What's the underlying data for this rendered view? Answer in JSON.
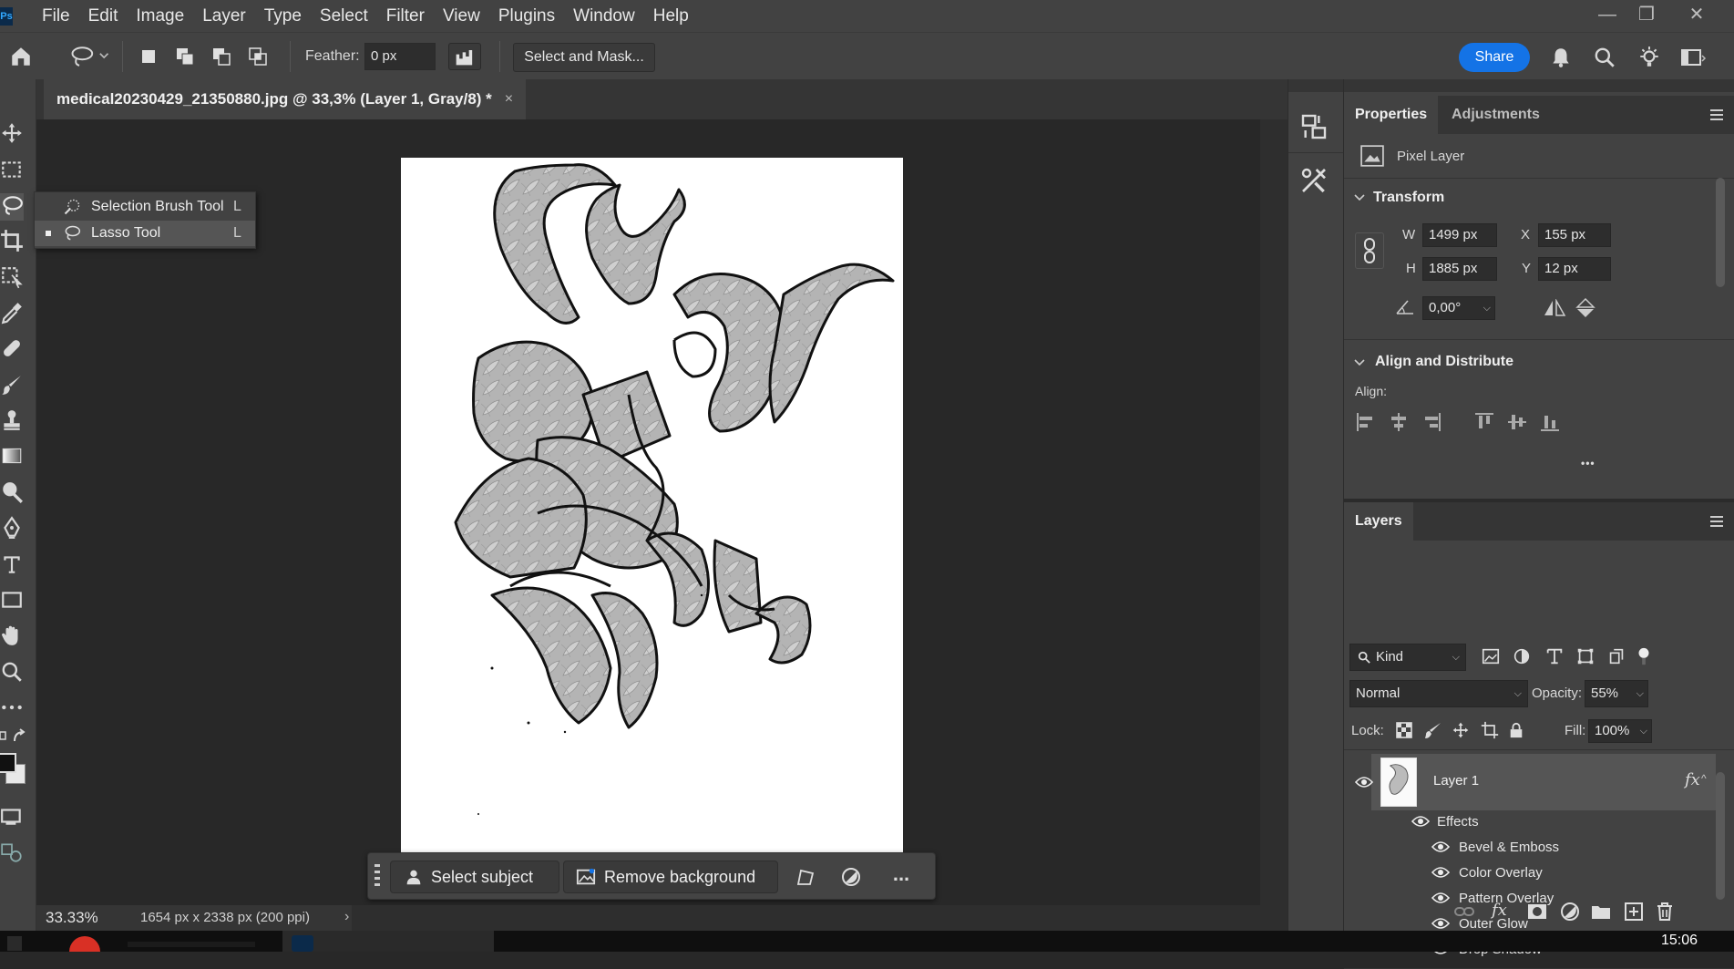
{
  "app": {
    "logo": "Ps"
  },
  "menu": [
    "File",
    "Edit",
    "Image",
    "Layer",
    "Type",
    "Select",
    "Filter",
    "View",
    "Plugins",
    "Window",
    "Help"
  ],
  "window_controls": {
    "minimize": "—",
    "restore": "❐",
    "close": "✕"
  },
  "options": {
    "feather_label": "Feather:",
    "feather_value": "0 px",
    "select_and_mask": "Select and Mask...",
    "share": "Share"
  },
  "document_tab": {
    "title": "medical20230429_21350880.jpg @ 33,3% (Layer 1, Gray/8) *",
    "close": "×"
  },
  "flyout": {
    "items": [
      {
        "label": "Selection Brush Tool",
        "key": "L"
      },
      {
        "label": "Lasso Tool",
        "key": "L"
      }
    ]
  },
  "taskbar": {
    "select_subject": "Select subject",
    "remove_background": "Remove background",
    "more": "..."
  },
  "status": {
    "zoom": "33.33%",
    "doc_info": "1654 px x 2338 px (200 ppi)",
    "arrow": "›"
  },
  "properties": {
    "tabs": [
      "Properties",
      "Adjustments"
    ],
    "layer_type": "Pixel Layer",
    "transform_title": "Transform",
    "w_label": "W",
    "w_value": "1499 px",
    "x_label": "X",
    "x_value": "155 px",
    "h_label": "H",
    "h_value": "1885 px",
    "y_label": "Y",
    "y_value": "12 px",
    "angle_value": "0,00°",
    "align_title": "Align and Distribute",
    "align_label": "Align:",
    "more": "•••"
  },
  "layers": {
    "tab": "Layers",
    "filter_kind": "Kind",
    "blend_mode": "Normal",
    "opacity_label": "Opacity:",
    "opacity_value": "55%",
    "lock_label": "Lock:",
    "fill_label": "Fill:",
    "fill_value": "100%",
    "layer_name": "Layer 1",
    "fx": "fx",
    "effects_label": "Effects",
    "effects": [
      "Bevel & Emboss",
      "Color Overlay",
      "Pattern Overlay",
      "Outer Glow",
      "Drop Shadow"
    ]
  },
  "system": {
    "clock": "15:06"
  },
  "colors": {
    "accent": "#1473e6",
    "panel": "#424242",
    "canvas": "#282828"
  }
}
